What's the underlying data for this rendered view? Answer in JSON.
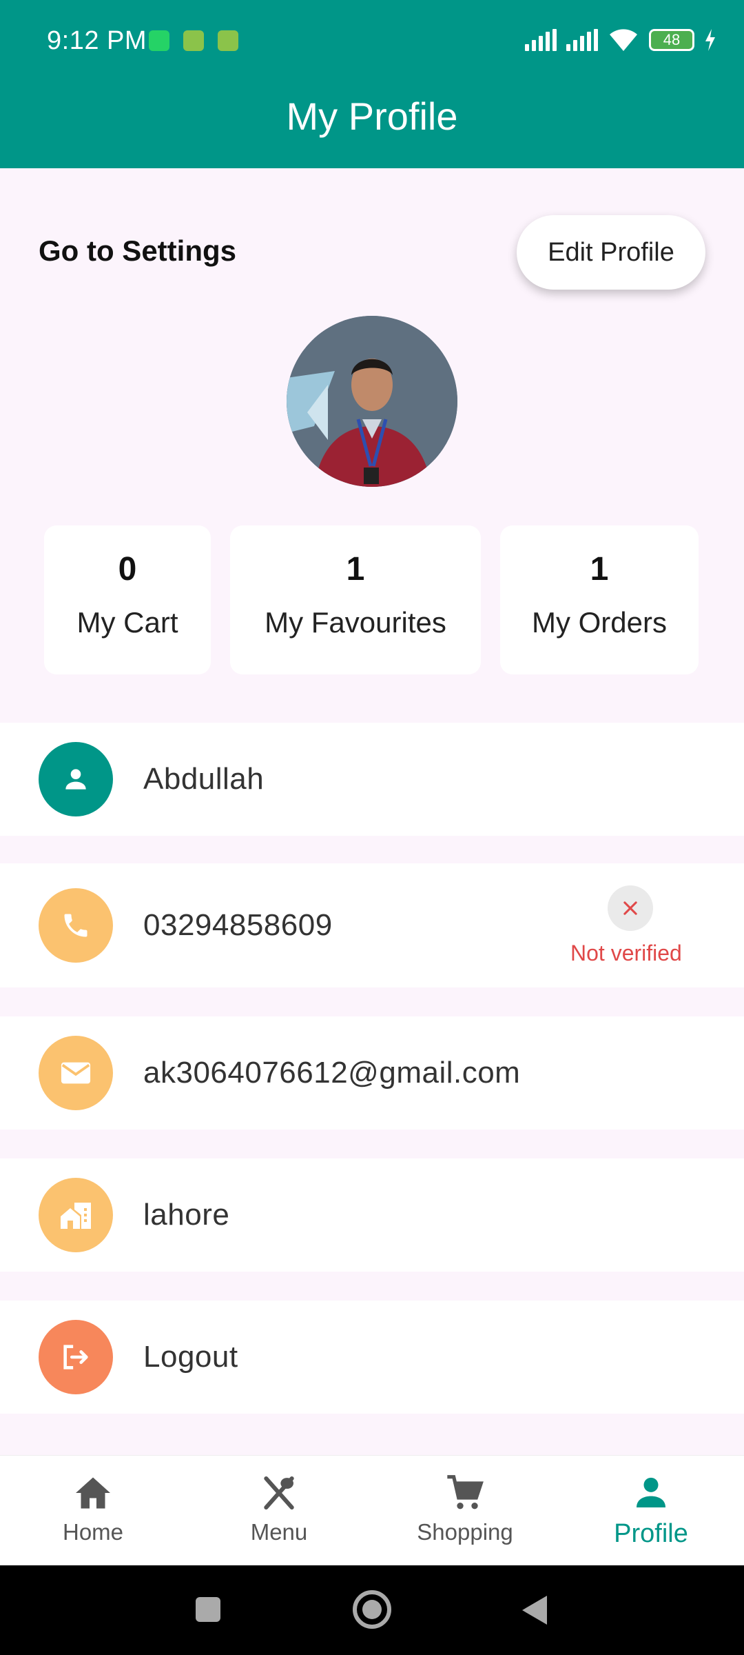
{
  "status_bar": {
    "time": "9:12 PM",
    "battery": "48"
  },
  "app_bar": {
    "title": "My Profile"
  },
  "header": {
    "settings_label": "Go to Settings",
    "edit_button": "Edit Profile"
  },
  "stats": [
    {
      "value": "0",
      "label": "My Cart"
    },
    {
      "value": "1",
      "label": "My Favourites"
    },
    {
      "value": "1",
      "label": "My Orders"
    }
  ],
  "rows": {
    "name": "Abdullah",
    "phone": "03294858609",
    "phone_status": "Not verified",
    "email": "ak3064076612@gmail.com",
    "city": "lahore",
    "logout": "Logout"
  },
  "bottom_nav": [
    {
      "label": "Home",
      "icon": "home-icon"
    },
    {
      "label": "Menu",
      "icon": "cutlery-icon"
    },
    {
      "label": "Shopping",
      "icon": "cart-icon"
    },
    {
      "label": "Profile",
      "icon": "person-icon",
      "active": true
    }
  ],
  "colors": {
    "primary": "#009688",
    "amber": "#fbc26f",
    "orange": "#f7875b",
    "error": "#e04848",
    "background": "#fcf4fc"
  }
}
